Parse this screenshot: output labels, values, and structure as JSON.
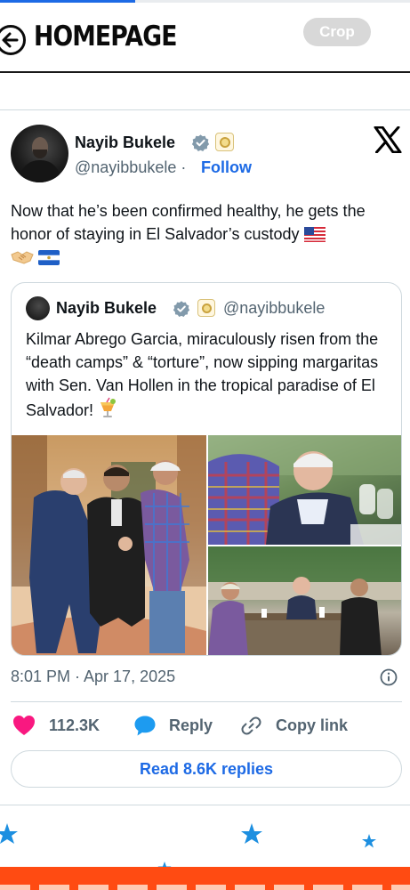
{
  "progress": {
    "value_percent": 33
  },
  "header": {
    "title": "HOMEPAGE",
    "back_icon": "back-arrow-icon",
    "crop_label": "Crop"
  },
  "tweet": {
    "author_name": "Nayib Bukele",
    "handle": "@nayibbukele",
    "separator": "·",
    "follow_label": "Follow",
    "text": "Now that he’s been confirmed healthy, he gets the honor of staying in El Salvador’s custody",
    "emojis": [
      "us-flag",
      "handshake",
      "el-salvador-flag"
    ],
    "quote": {
      "author_name": "Nayib Bukele",
      "handle": "@nayibbukele",
      "text": "Kilmar Abrego Garcia, miraculously risen from the “death camps” & “torture”, now sipping margaritas with Sen. Van Hollen in the tropical paradise of El Salvador!",
      "emoji": "tropical-drink",
      "photo_count": 3
    },
    "timestamp": "8:01 PM · Apr 17, 2025",
    "likes": "112.3K",
    "reply_label": "Reply",
    "copy_link_label": "Copy link",
    "read_replies_label": "Read 8.6K replies"
  },
  "colors": {
    "accent_blue": "#1d6ae5",
    "heart_pink": "#f91880",
    "reply_blue": "#1d9bf0",
    "secondary_text": "#536471",
    "banner_orange": "#ff4b12",
    "star_blue": "#1d8fe0"
  }
}
